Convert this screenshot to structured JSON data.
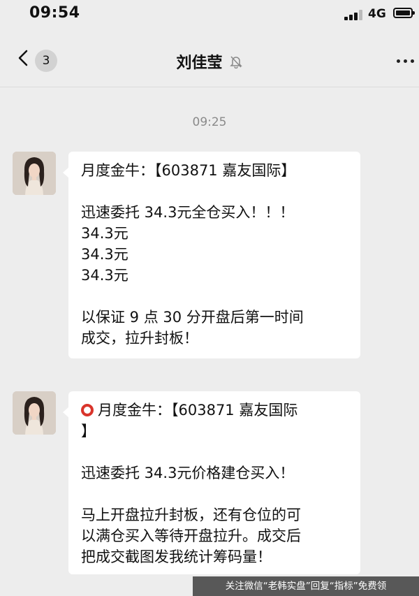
{
  "status_bar": {
    "time": "09:54",
    "network": "4G",
    "battery_fill": 0.8
  },
  "nav": {
    "back_count": "3",
    "title": "刘佳莹"
  },
  "chat": {
    "timestamp": "09:25",
    "messages": [
      {
        "lines": [
          "月度金牛：【603871 嘉友国际】",
          "",
          "迅速委托 34.3元全仓买入！！！",
          "34.3元",
          "34.3元",
          "34.3元",
          "",
          "以保证 9 点 30 分开盘后第一时间",
          "成交，拉升封板！"
        ]
      },
      {
        "lines": [
          "月度金牛：【603871 嘉友国际",
          "】",
          "",
          "迅速委托 34.3元价格建仓买入！",
          "",
          "马上开盘拉升封板，还有仓位的可",
          "以满仓买入等待开盘拉升。成交后",
          "把成交截图发我统计筹码量！"
        ]
      }
    ]
  },
  "watermark": "关注微信“老韩实盘”回复“指标”免费领"
}
